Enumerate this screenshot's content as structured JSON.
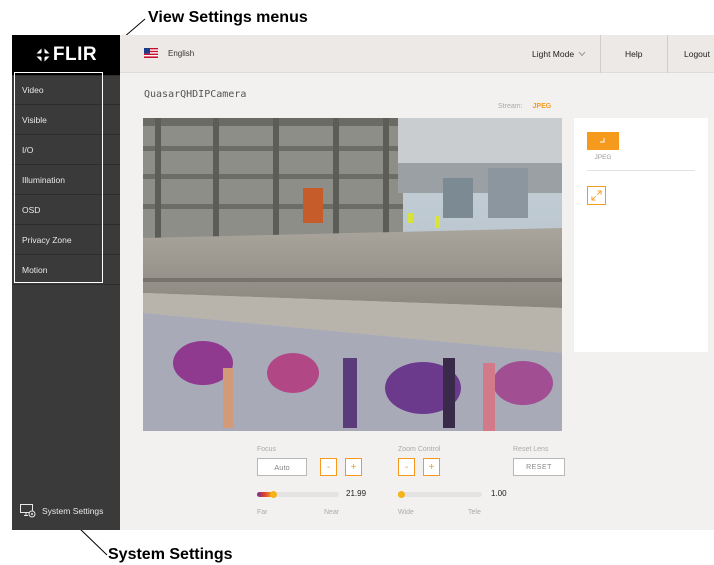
{
  "annotations": {
    "view_settings": "View Settings menus",
    "system_settings": "System Settings"
  },
  "brand": {
    "logo": "FLIR"
  },
  "sidebar": {
    "items": [
      {
        "label": "Video"
      },
      {
        "label": "Visible"
      },
      {
        "label": "I/O"
      },
      {
        "label": "Illumination"
      },
      {
        "label": "OSD"
      },
      {
        "label": "Privacy Zone"
      },
      {
        "label": "Motion"
      }
    ],
    "system_settings": "System Settings"
  },
  "topbar": {
    "language": "English",
    "theme": "Light Mode",
    "help": "Help",
    "logout": "Logout"
  },
  "camera": {
    "name": "QuasarQHDIPCamera",
    "stream_label": "Stream:",
    "stream_value": "JPEG"
  },
  "side_panel": {
    "format_label": "JPEG"
  },
  "controls": {
    "focus": {
      "label": "Focus",
      "auto_label": "Auto",
      "minus": "-",
      "plus": "+",
      "value": "21.99",
      "fraction": 0.2,
      "min_label": "Far",
      "max_label": "Near"
    },
    "zoom": {
      "label": "Zoom Control",
      "minus": "-",
      "plus": "+",
      "value": "1.00",
      "fraction": 0.0,
      "min_label": "Wide",
      "max_label": "Tele"
    },
    "reset": {
      "label": "Reset Lens",
      "button": "RESET"
    }
  },
  "colors": {
    "accent": "#f59a1d",
    "sidebar_bg": "#3a3a3a",
    "topbar_bg": "#ede9e6",
    "focus_gradient": [
      "#7a2a8c",
      "#f5b21d"
    ]
  }
}
